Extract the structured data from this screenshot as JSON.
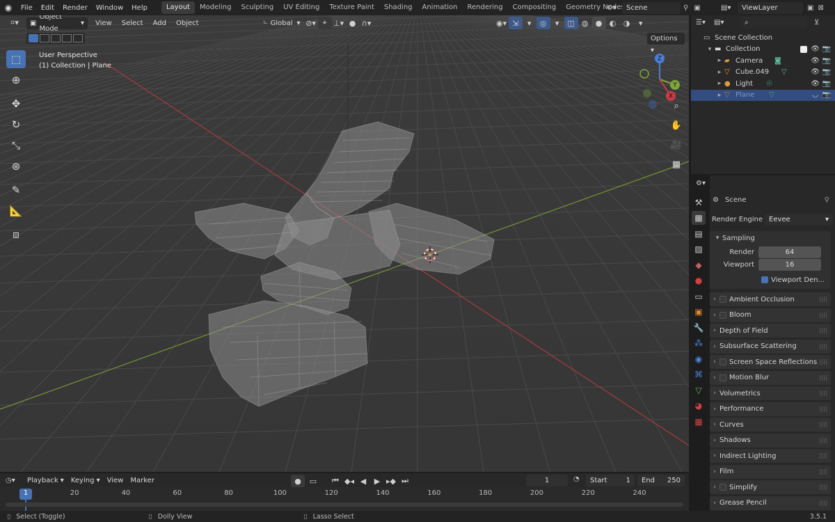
{
  "menubar": {
    "menus": [
      "File",
      "Edit",
      "Render",
      "Window",
      "Help"
    ],
    "workspaces": [
      "Layout",
      "Modeling",
      "Sculpting",
      "UV Editing",
      "Texture Paint",
      "Shading",
      "Animation",
      "Rendering",
      "Compositing",
      "Geometry Nodes"
    ],
    "active_workspace": "Layout",
    "scene": "Scene",
    "view_layer": "ViewLayer"
  },
  "viewport": {
    "mode": "Object Mode",
    "menus": [
      "View",
      "Select",
      "Add",
      "Object"
    ],
    "orientation": "Global",
    "options_label": "Options",
    "info_line1": "User Perspective",
    "info_line2": "(1) Collection | Plane",
    "gizmo": {
      "x": "X",
      "y": "Y",
      "z": "Z"
    },
    "axis_colors": {
      "x": "#c63d45",
      "y": "#7ea53a",
      "z": "#4a7fd6"
    }
  },
  "outliner": {
    "root": "Scene Collection",
    "collection": "Collection",
    "items": [
      {
        "name": "Camera",
        "icon": "camera-icon"
      },
      {
        "name": "Cube.049",
        "icon": "mesh-icon"
      },
      {
        "name": "Light",
        "icon": "light-icon"
      },
      {
        "name": "Plane",
        "icon": "mesh-icon",
        "selected": true
      }
    ]
  },
  "properties": {
    "context": "Scene",
    "render_engine_label": "Render Engine",
    "render_engine": "Eevee",
    "sampling": {
      "label": "Sampling",
      "render_label": "Render",
      "render": "64",
      "viewport_label": "Viewport",
      "viewport": "16",
      "denoise_label": "Viewport Den..."
    },
    "panels": [
      {
        "label": "Ambient Occlusion",
        "checkbox": true
      },
      {
        "label": "Bloom",
        "checkbox": true
      },
      {
        "label": "Depth of Field",
        "checkbox": false
      },
      {
        "label": "Subsurface Scattering",
        "checkbox": false
      },
      {
        "label": "Screen Space Reflections",
        "checkbox": true
      },
      {
        "label": "Motion Blur",
        "checkbox": true
      },
      {
        "label": "Volumetrics",
        "checkbox": false
      },
      {
        "label": "Performance",
        "checkbox": false
      },
      {
        "label": "Curves",
        "checkbox": false
      },
      {
        "label": "Shadows",
        "checkbox": false
      },
      {
        "label": "Indirect Lighting",
        "checkbox": false
      },
      {
        "label": "Film",
        "checkbox": false
      },
      {
        "label": "Simplify",
        "checkbox": true
      },
      {
        "label": "Grease Pencil",
        "checkbox": false
      }
    ]
  },
  "timeline": {
    "menus": [
      "Playback",
      "Keying",
      "View",
      "Marker"
    ],
    "current_frame": "1",
    "start_label": "Start",
    "start": "1",
    "end_label": "End",
    "end": "250",
    "ticks": [
      "1",
      "20",
      "40",
      "60",
      "80",
      "100",
      "120",
      "140",
      "160",
      "180",
      "200",
      "220",
      "240"
    ]
  },
  "statusbar": {
    "select": "Select (Toggle)",
    "dolly": "Dolly View",
    "lasso": "Lasso Select",
    "version": "3.5.1"
  }
}
